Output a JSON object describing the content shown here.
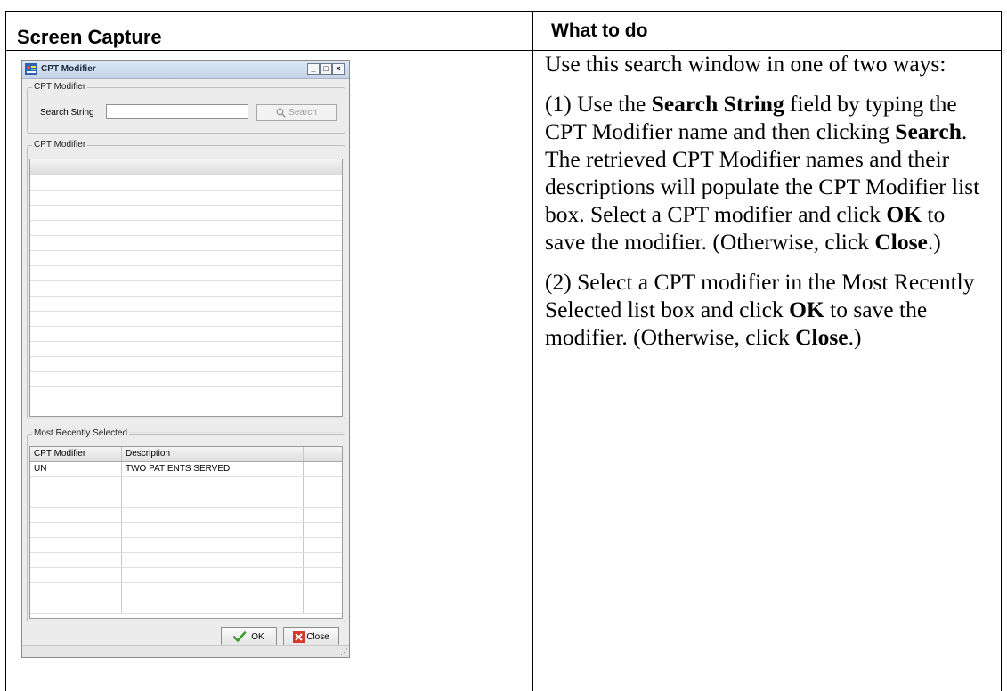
{
  "table": {
    "col1_header": "Screen Capture",
    "col2_header": "What to do"
  },
  "window": {
    "title": "CPT Modifier",
    "title_buttons": {
      "minimize": "_",
      "maximize": "□",
      "close": "×"
    },
    "search_group": {
      "label": "CPT Modifier",
      "search_string_label": "Search String",
      "search_value": "",
      "search_button": "Search"
    },
    "results_group": {
      "label": "CPT Modifier",
      "rows": 17
    },
    "recent_group": {
      "label": "Most Recently Selected",
      "columns": [
        "CPT Modifier",
        "Description"
      ],
      "rows": [
        {
          "code": "UN",
          "description": "TWO PATIENTS SERVED"
        }
      ]
    },
    "ok_button": "OK",
    "close_button": "Close"
  },
  "instructions": {
    "p1": "Use this search window in one of two ways:",
    "p2": {
      "t1": "(1) Use the ",
      "b1": "Search String",
      "t2": " field by typing the CPT Modifier name and then clicking ",
      "b2": "Search",
      "t3": ". The retrieved CPT Modifier names and their descriptions will populate the CPT Modifier list box. Select a CPT modifier and click ",
      "b3": "OK",
      "t4": " to save the modifier. (Otherwise, click ",
      "b4": "Close",
      "t5": ".)"
    },
    "p3": {
      "t1": "(2) Select a CPT modifier in the Most Recently Selected list box and click ",
      "b1": "OK",
      "t2": " to save the modifier. (Otherwise, click ",
      "b2": "Close",
      "t3": ".)"
    }
  },
  "colors": {
    "ok_check": "#3f9c2c",
    "close_x": "#d23a2a"
  },
  "icons": {
    "search": "magnifier-icon",
    "ok": "checkmark-icon",
    "close": "red-x-icon",
    "app": "app-window-icon"
  }
}
